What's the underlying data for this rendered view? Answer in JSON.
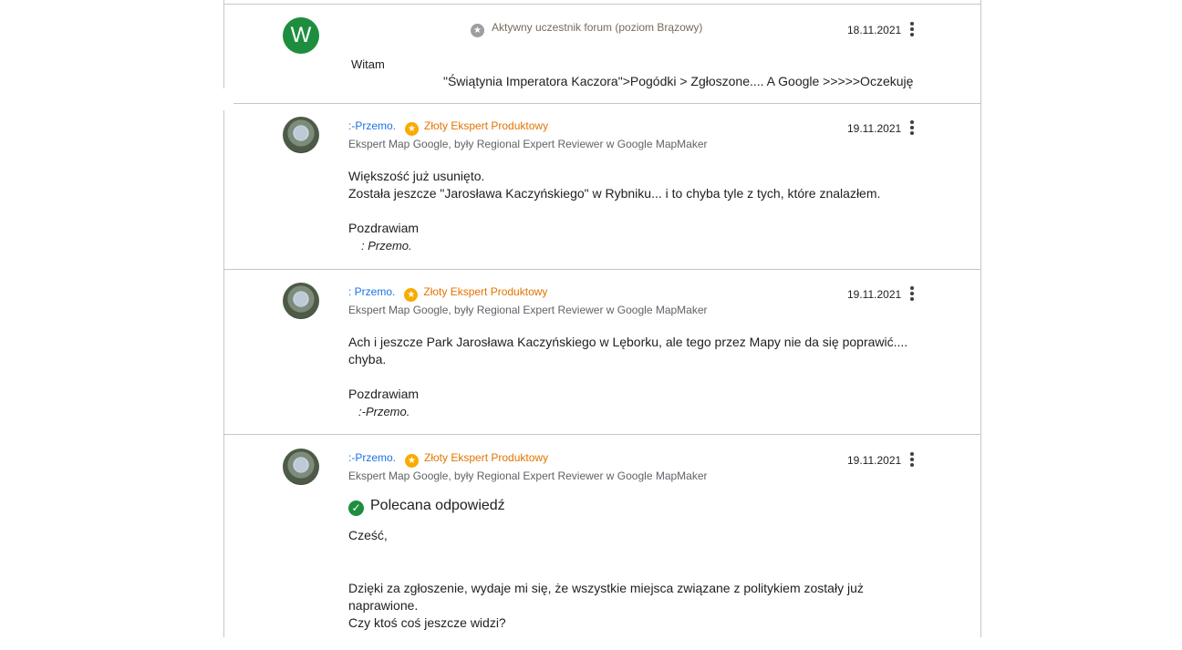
{
  "posts": [
    {
      "avatar_letter": "W",
      "level_label": "Aktywny uczestnik forum (poziom Brązowy)",
      "date": "18.11.2021",
      "greeting": "Witam",
      "path_text": "\"Świątynia Imperatora Kaczora\">Pogódki > Zgłoszone.... A Google >>>>>Oczekuję"
    },
    {
      "author": ":-Przemo.",
      "badge": "Złoty Ekspert Produktowy",
      "subtitle": "Ekspert Map Google, były Regional Expert Reviewer w Google MapMaker",
      "date": "19.11.2021",
      "line1": "Większość już usunięto.",
      "line2": "Została jeszcze \"Jarosława Kaczyńskiego\" w Rybniku... i to chyba tyle z tych, które znalazłem.",
      "closing": "Pozdrawiam",
      "signature": ": Przemo."
    },
    {
      "author": ": Przemo.",
      "badge": "Złoty Ekspert Produktowy",
      "subtitle": "Ekspert Map Google, były Regional Expert Reviewer w Google MapMaker",
      "date": "19.11.2021",
      "line1": "Ach i jeszcze Park Jarosława Kaczyńskiego w Lęborku, ale tego przez Mapy nie da się poprawić....",
      "line2": "chyba.",
      "closing": "Pozdrawiam",
      "signature": ":-Przemo."
    },
    {
      "author": ":-Przemo.",
      "badge": "Złoty Ekspert Produktowy",
      "subtitle": "Ekspert Map Google, były Regional Expert Reviewer w Google MapMaker",
      "date": "19.11.2021",
      "recommended": "Polecana odpowiedź",
      "greeting": "Cześć,",
      "line1": "Dzięki za zgłoszenie, wydaje mi się, że wszystkie miejsca związane z politykiem zostały już",
      "line2": "naprawione.",
      "line3": "Czy ktoś coś jeszcze widzi?"
    }
  ],
  "icons": {
    "star": "★",
    "check": "✓"
  },
  "colors": {
    "author_link": "#1a73e8",
    "expert_badge": "#e37400",
    "gold_star": "#f9ab00",
    "avatar_green": "#1e8e3e"
  }
}
